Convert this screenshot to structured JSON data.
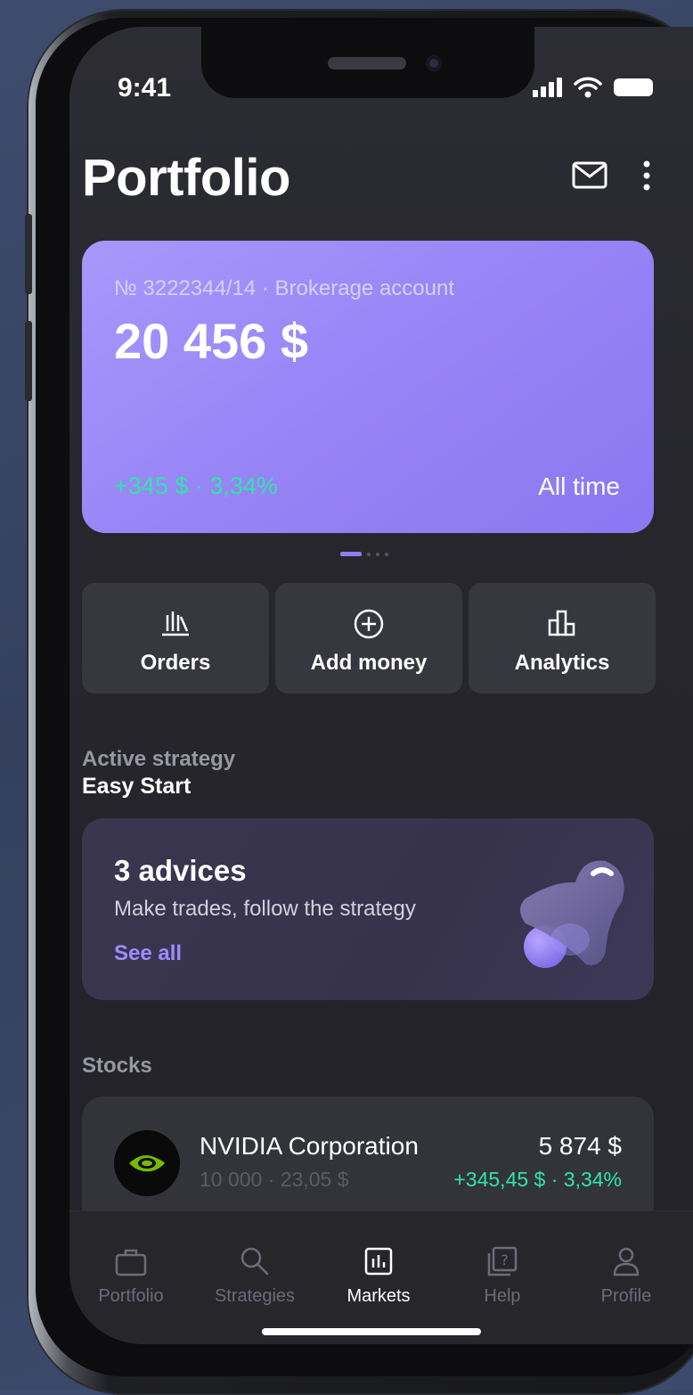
{
  "status_bar": {
    "time": "9:41"
  },
  "header": {
    "title": "Portfolio"
  },
  "account_card": {
    "account_line": "№ 3222344/14 · Brokerage account",
    "balance": "20 456 $",
    "change": "+345 $ · 3,34%",
    "period": "All time"
  },
  "carousel": {
    "pages": 4,
    "active_page": 1
  },
  "actions": [
    {
      "label": "Orders",
      "icon": "orders-icon"
    },
    {
      "label": "Add money",
      "icon": "plus-circle-icon"
    },
    {
      "label": "Analytics",
      "icon": "analytics-icon"
    }
  ],
  "strategy": {
    "caption": "Active strategy",
    "name": "Easy Start",
    "advice_title": "3 advices",
    "advice_subtitle": "Make trades, follow the strategy",
    "advice_link": "See all",
    "illustration": "bell-icon"
  },
  "stocks": {
    "caption": "Stocks",
    "items": [
      {
        "name": "NVIDIA Corporation",
        "quantity": "10 000 · 23,05 $",
        "value": "5 874 $",
        "change": "+345,45 $ · 3,34%",
        "logo": "nvidia-logo"
      }
    ]
  },
  "tabbar": {
    "tabs": [
      {
        "label": "Portfolio",
        "icon": "briefcase-icon"
      },
      {
        "label": "Strategies",
        "icon": "search-icon"
      },
      {
        "label": "Markets",
        "icon": "chart-icon",
        "active": true
      },
      {
        "label": "Help",
        "icon": "help-icon"
      },
      {
        "label": "Profile",
        "icon": "user-icon"
      }
    ]
  },
  "colors": {
    "accent": "#9784f6",
    "positive": "#2ee6a6",
    "background": "#2a2a30",
    "card": "#37373f"
  }
}
